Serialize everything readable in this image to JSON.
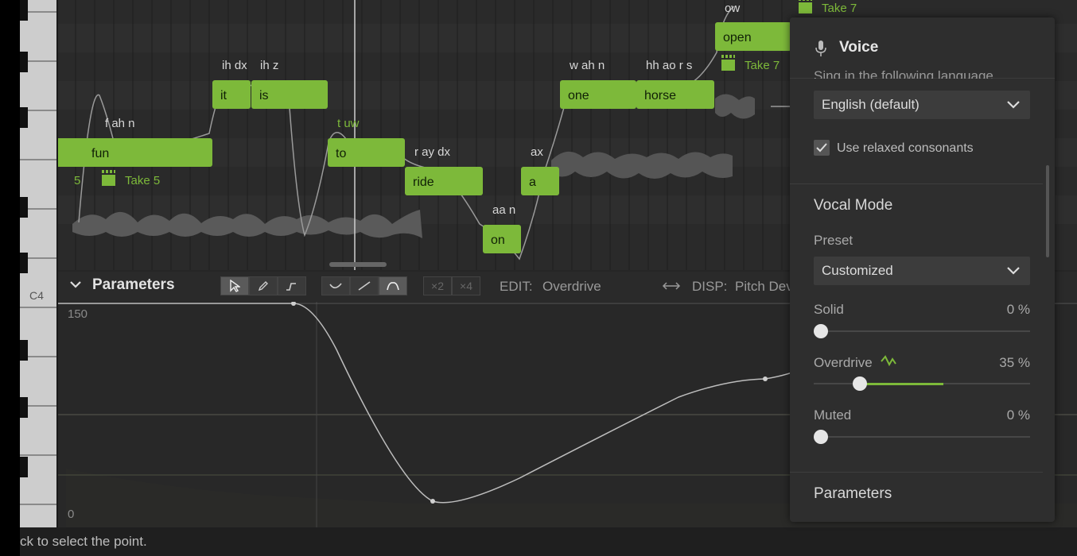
{
  "piano": {
    "c4_label": "C4"
  },
  "notes": [
    {
      "lyric": "fun",
      "phoneme": "f ah n"
    },
    {
      "lyric": "it",
      "phoneme": "ih dx"
    },
    {
      "lyric": "is",
      "phoneme": "ih z"
    },
    {
      "lyric": "to",
      "phoneme": "t uw"
    },
    {
      "lyric": "ride",
      "phoneme": "r ay dx"
    },
    {
      "lyric": "on",
      "phoneme": "aa n"
    },
    {
      "lyric": "a",
      "phoneme": "ax"
    },
    {
      "lyric": "one",
      "phoneme": "w ah n"
    },
    {
      "lyric": "horse",
      "phoneme": "hh ao r s"
    },
    {
      "lyric": "open",
      "phoneme": "ow"
    }
  ],
  "takes": {
    "take5": "Take 5",
    "take7a": "Take 7",
    "take7b": "Take 7",
    "partial": "5"
  },
  "parameters_toolbar": {
    "title": "Parameters",
    "x2": "×2",
    "x4": "×4",
    "edit_label": "EDIT:",
    "edit_value": "Overdrive",
    "disp_label": "DISP:",
    "disp_value": "Pitch Deviati"
  },
  "graph": {
    "y_max": "150",
    "y_min": "0"
  },
  "status": {
    "text": "ck to select the point."
  },
  "voice_panel": {
    "title": "Voice",
    "cut_text": "Sing in the following language",
    "language": "English (default)",
    "relaxed_label": "Use relaxed consonants",
    "relaxed_checked": true,
    "vocal_mode_heading": "Vocal Mode",
    "preset_label": "Preset",
    "preset_value": "Customized",
    "sliders": [
      {
        "label": "Solid",
        "value_text": "0 %",
        "value": 0
      },
      {
        "label": "Overdrive",
        "value_text": "35 %",
        "value": 35
      },
      {
        "label": "Muted",
        "value_text": "0 %",
        "value": 0
      }
    ],
    "parameters_heading": "Parameters"
  },
  "colors": {
    "accent": "#7db93a",
    "panel": "#2e2e2e",
    "background": "#262626"
  }
}
